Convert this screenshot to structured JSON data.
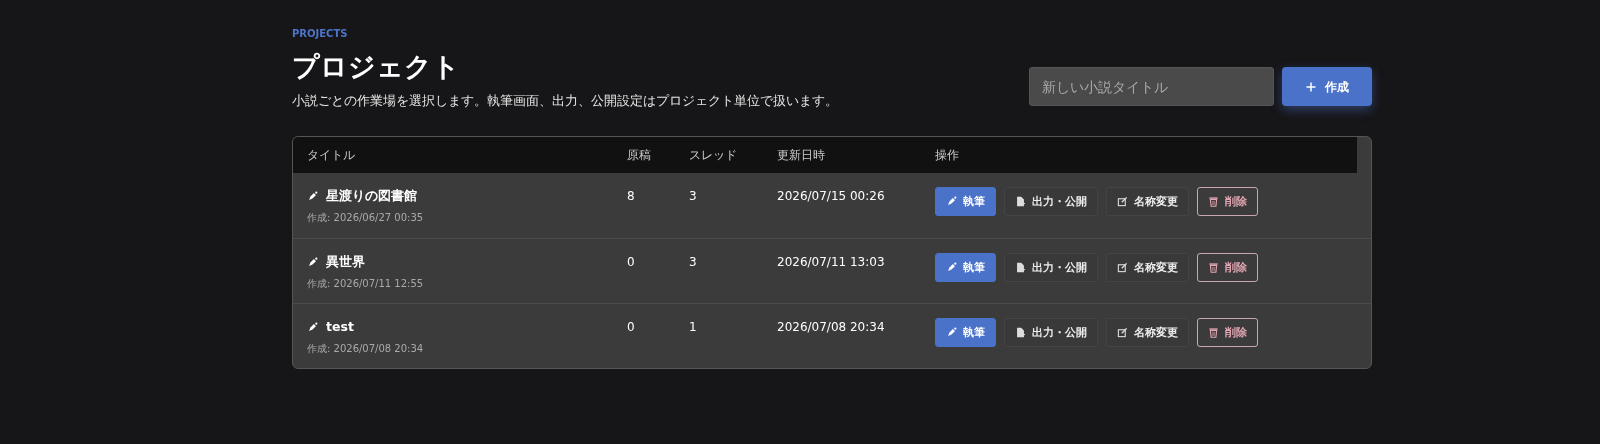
{
  "header": {
    "eyebrow": "PROJECTS",
    "title": "プロジェクト",
    "description": "小説ごとの作業場を選択します。執筆画面、出力、公開設定はプロジェクト単位で扱います。"
  },
  "new_project": {
    "placeholder": "新しい小説タイトル",
    "button": "作成"
  },
  "table": {
    "columns": [
      "タイトル",
      "原稿",
      "スレッド",
      "更新日時",
      "操作"
    ],
    "rows": [
      {
        "title": "星渡りの図書館",
        "created": "作成: 2026/06/27 00:35",
        "manuscripts": "8",
        "threads": "3",
        "updated": "2026/07/15 00:26",
        "actions": [
          {
            "kind": "write",
            "label": "執筆"
          },
          {
            "kind": "export",
            "label": "出力・公開"
          },
          {
            "kind": "rename",
            "label": "名称変更"
          },
          {
            "kind": "delete",
            "label": "削除"
          }
        ]
      },
      {
        "title": "異世界",
        "created": "作成: 2026/07/11 12:55",
        "manuscripts": "0",
        "threads": "3",
        "updated": "2026/07/11 13:03",
        "actions": [
          {
            "kind": "write",
            "label": "執筆"
          },
          {
            "kind": "export",
            "label": "出力・公開"
          },
          {
            "kind": "rename",
            "label": "名称変更"
          },
          {
            "kind": "delete",
            "label": "削除"
          }
        ]
      },
      {
        "title": "test",
        "created": "作成: 2026/07/08 20:34",
        "manuscripts": "0",
        "threads": "1",
        "updated": "2026/07/08 20:34",
        "actions": [
          {
            "kind": "write",
            "label": "執筆"
          },
          {
            "kind": "export",
            "label": "出力・公開"
          },
          {
            "kind": "rename",
            "label": "名称変更"
          },
          {
            "kind": "delete",
            "label": "削除"
          }
        ]
      }
    ]
  }
}
